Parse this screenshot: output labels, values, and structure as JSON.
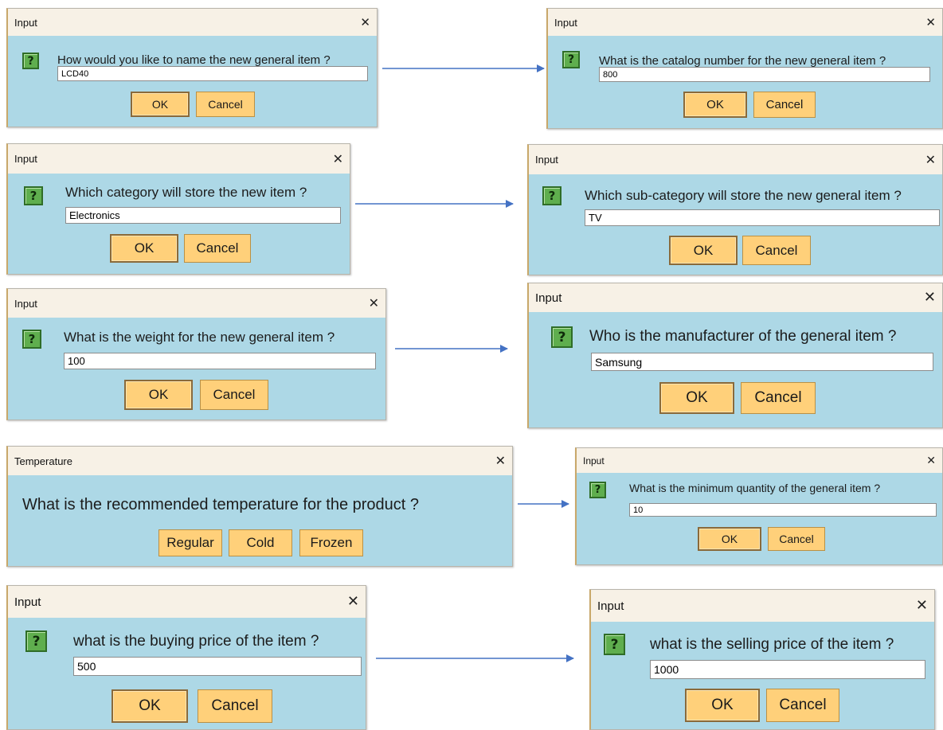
{
  "colors": {
    "dialog_bg": "#add8e6",
    "titlebar_bg": "#f7f1e6",
    "button_bg": "#ffd07a",
    "icon_bg": "#5fae4e",
    "arrow": "#4472c4"
  },
  "icons": {
    "question": "?",
    "close": "✕"
  },
  "dialogs": {
    "name": {
      "title": "Input",
      "prompt": "How would you like to name the new general item ?",
      "value": "LCD40",
      "ok": "OK",
      "cancel": "Cancel"
    },
    "catalog": {
      "title": "Input",
      "prompt": "What is the catalog number for the new general item ?",
      "value": "800",
      "ok": "OK",
      "cancel": "Cancel"
    },
    "category": {
      "title": "Input",
      "prompt": "Which category will store the new item ?",
      "value": "Electronics",
      "ok": "OK",
      "cancel": "Cancel"
    },
    "subcategory": {
      "title": "Input",
      "prompt": "Which sub-category will store the new general item ?",
      "value": "TV",
      "ok": "OK",
      "cancel": "Cancel"
    },
    "weight": {
      "title": "Input",
      "prompt": "What is the weight for the new general item ?",
      "value": "100",
      "ok": "OK",
      "cancel": "Cancel"
    },
    "manufacturer": {
      "title": "Input",
      "prompt": "Who is the manufacturer of the general item ?",
      "value": "Samsung",
      "ok": "OK",
      "cancel": "Cancel"
    },
    "temperature": {
      "title": "Temperature",
      "prompt": "What is the recommended temperature for the product ?",
      "options": [
        "Regular",
        "Cold",
        "Frozen"
      ]
    },
    "min_quantity": {
      "title": "Input",
      "prompt": "What is the minimum quantity of the general item ?",
      "value": "10",
      "ok": "OK",
      "cancel": "Cancel"
    },
    "buying_price": {
      "title": "Input",
      "prompt": "what is the buying price of the item ?",
      "value": "500",
      "ok": "OK",
      "cancel": "Cancel"
    },
    "selling_price": {
      "title": "Input",
      "prompt": "what is the selling price of the item ?",
      "value": "1000",
      "ok": "OK",
      "cancel": "Cancel"
    }
  }
}
